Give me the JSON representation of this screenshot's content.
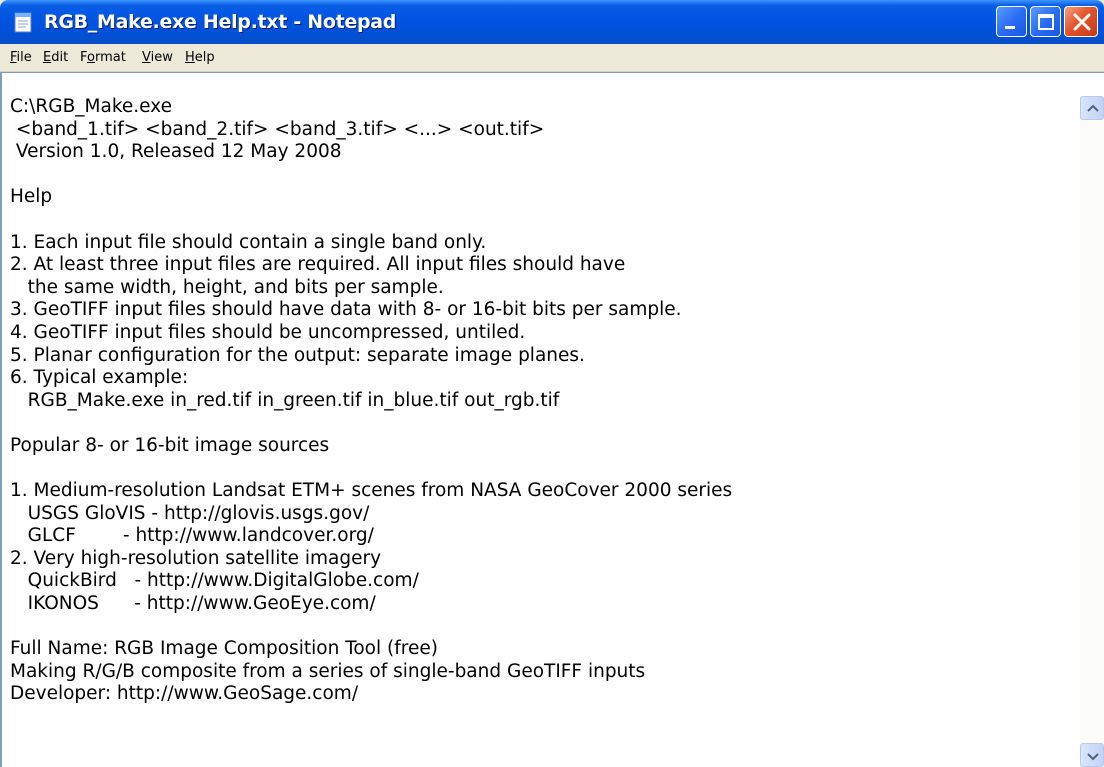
{
  "window": {
    "title": "RGB_Make.exe Help.txt - Notepad"
  },
  "menu": [
    {
      "label": "File",
      "accel": "F",
      "rest": "ile"
    },
    {
      "label": "Edit",
      "accel": "E",
      "rest": "dit"
    },
    {
      "label": "Format",
      "accel": "o",
      "pre": "F",
      "rest": "rmat"
    },
    {
      "label": "View",
      "accel": "V",
      "rest": "iew"
    },
    {
      "label": "Help",
      "accel": "H",
      "rest": "elp"
    }
  ],
  "document": {
    "text": "C:\\RGB_Make.exe\n <band_1.tif> <band_2.tif> <band_3.tif> <...> <out.tif>\n Version 1.0, Released 12 May 2008\n\nHelp\n\n1. Each input file should contain a single band only.\n2. At least three input files are required. All input files should have\n   the same width, height, and bits per sample.\n3. GeoTIFF input files should have data with 8- or 16-bit bits per sample.\n4. GeoTIFF input files should be uncompressed, untiled.\n5. Planar configuration for the output: separate image planes.\n6. Typical example:\n   RGB_Make.exe in_red.tif in_green.tif in_blue.tif out_rgb.tif\n\nPopular 8- or 16-bit image sources\n\n1. Medium-resolution Landsat ETM+ scenes from NASA GeoCover 2000 series\n   USGS GloVIS - http://glovis.usgs.gov/\n   GLCF        - http://www.landcover.org/\n2. Very high-resolution satellite imagery\n   QuickBird   - http://www.DigitalGlobe.com/\n   IKONOS      - http://www.GeoEye.com/\n\nFull Name: RGB Image Composition Tool (free)\nMaking R/G/B composite from a series of single-band GeoTIFF inputs\nDeveloper: http://www.GeoSage.com/"
  },
  "icons": {
    "app": "notepad-icon",
    "minimize": "minimize-icon",
    "maximize": "maximize-icon",
    "close": "close-icon",
    "scroll_up": "scroll-up-arrow-icon",
    "scroll_down": "scroll-down-arrow-icon"
  },
  "colors": {
    "titlebar": "#0054e3",
    "close_button": "#e2542c",
    "chrome": "#ece9d8"
  }
}
